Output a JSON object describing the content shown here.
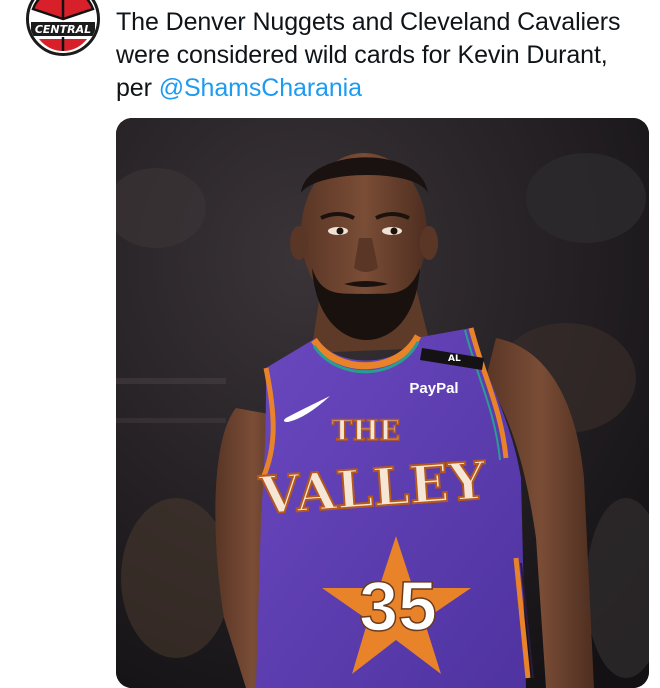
{
  "tweet": {
    "line1": "The Denver Nuggets and Cleveland Cavaliers",
    "line2": "were considered wild cards for Kevin Durant,",
    "line3_prefix": "per ",
    "mention": "@ShamsCharania"
  },
  "avatar": {
    "logo_text": "CENTRAL",
    "accent": "#d8202a"
  },
  "media": {
    "jersey": {
      "word1": "THE",
      "word2": "VALLEY",
      "number": "35",
      "sponsor": "PayPal",
      "tag": "AL"
    },
    "colors": {
      "jersey": "#5f3fb2",
      "trim": "#e8832a",
      "teal": "#2a9c92",
      "skin": "#6a4430"
    }
  }
}
